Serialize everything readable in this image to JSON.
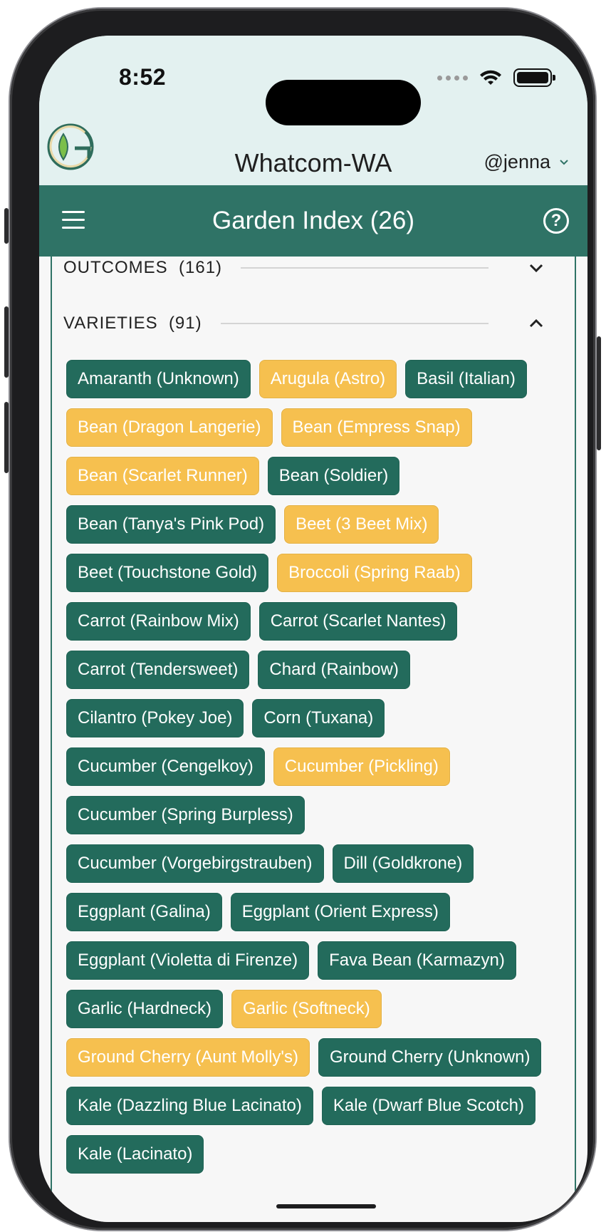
{
  "status_bar": {
    "time": "8:52"
  },
  "header": {
    "site_name": "Whatcom-WA",
    "user": "@jenna",
    "brand_color": "#2f7366",
    "header_bg": "#e3f1f0"
  },
  "appbar": {
    "title": "Garden Index (26)"
  },
  "sections": {
    "outcomes": {
      "label": "OUTCOMES",
      "count": "(161)"
    },
    "varieties": {
      "label": "VARIETIES",
      "count": "(91)"
    }
  },
  "colors": {
    "green_chip": "#236b5c",
    "yellow_chip": "#f6c04f"
  },
  "varieties": [
    {
      "label": "Amaranth (Unknown)",
      "color": "green"
    },
    {
      "label": "Arugula (Astro)",
      "color": "yellow"
    },
    {
      "label": "Basil (Italian)",
      "color": "green"
    },
    {
      "label": "Bean (Dragon Langerie)",
      "color": "yellow"
    },
    {
      "label": "Bean (Empress Snap)",
      "color": "yellow"
    },
    {
      "label": "Bean (Scarlet Runner)",
      "color": "yellow"
    },
    {
      "label": "Bean (Soldier)",
      "color": "green"
    },
    {
      "label": "Bean (Tanya's Pink Pod)",
      "color": "green"
    },
    {
      "label": "Beet (3 Beet Mix)",
      "color": "yellow"
    },
    {
      "label": "Beet (Touchstone Gold)",
      "color": "green"
    },
    {
      "label": "Broccoli (Spring Raab)",
      "color": "yellow"
    },
    {
      "label": "Carrot (Rainbow Mix)",
      "color": "green"
    },
    {
      "label": "Carrot (Scarlet Nantes)",
      "color": "green"
    },
    {
      "label": "Carrot (Tendersweet)",
      "color": "green"
    },
    {
      "label": "Chard (Rainbow)",
      "color": "green"
    },
    {
      "label": "Cilantro (Pokey Joe)",
      "color": "green"
    },
    {
      "label": "Corn (Tuxana)",
      "color": "green"
    },
    {
      "label": "Cucumber (Cengelkoy)",
      "color": "green"
    },
    {
      "label": "Cucumber (Pickling)",
      "color": "yellow"
    },
    {
      "label": "Cucumber (Spring Burpless)",
      "color": "green"
    },
    {
      "label": "Cucumber (Vorgebirgstrauben)",
      "color": "green"
    },
    {
      "label": "Dill (Goldkrone)",
      "color": "green"
    },
    {
      "label": "Eggplant (Galina)",
      "color": "green"
    },
    {
      "label": "Eggplant (Orient Express)",
      "color": "green"
    },
    {
      "label": "Eggplant (Violetta di Firenze)",
      "color": "green"
    },
    {
      "label": "Fava Bean (Karmazyn)",
      "color": "green"
    },
    {
      "label": "Garlic (Hardneck)",
      "color": "green"
    },
    {
      "label": "Garlic (Softneck)",
      "color": "yellow"
    },
    {
      "label": "Ground Cherry (Aunt Molly's)",
      "color": "yellow"
    },
    {
      "label": "Ground Cherry (Unknown)",
      "color": "green"
    },
    {
      "label": "Kale (Dazzling Blue Lacinato)",
      "color": "green"
    },
    {
      "label": "Kale (Dwarf Blue Scotch)",
      "color": "green"
    },
    {
      "label": "Kale (Lacinato)",
      "color": "green"
    }
  ]
}
